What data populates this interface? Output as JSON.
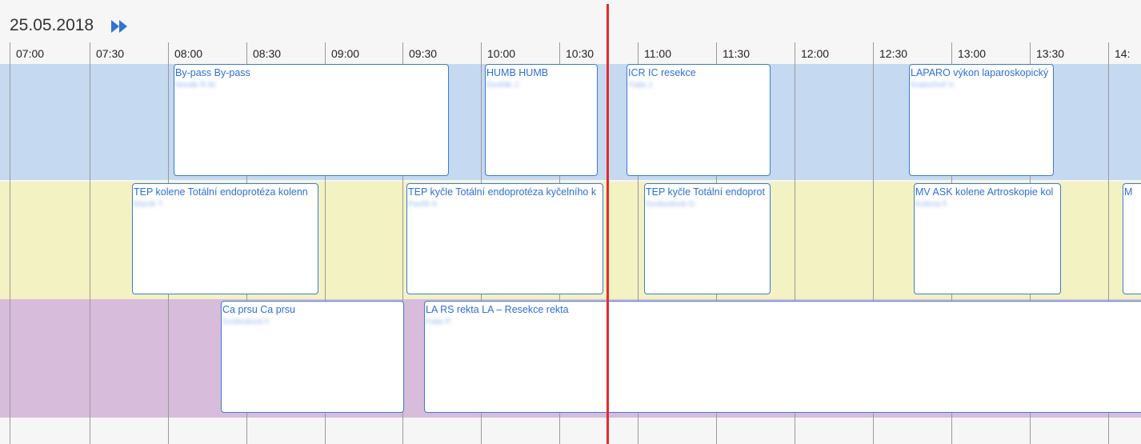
{
  "header": {
    "date": "25.05.2018",
    "next_icon": "double-chevron-right-icon"
  },
  "time_ticks": [
    "07:00",
    "07:30",
    "08:00",
    "08:30",
    "09:00",
    "09:30",
    "10:00",
    "10:30",
    "11:00",
    "11:30",
    "12:00",
    "12:30",
    "13:00",
    "13:30",
    "14:"
  ],
  "colors": {
    "lane_1": "#c5d9f0",
    "lane_2": "#f2f2c3",
    "lane_3": "#d7bcdb",
    "booking_border": "#3f7ad6",
    "booking_text": "#2e6fd6",
    "now_line": "#e32b2b"
  },
  "lanes": [
    {
      "bookings": [
        {
          "title": "By-pass By-pass",
          "person": "Novák R.M."
        },
        {
          "title": "HUMB HUMB",
          "person": "Dvořák J."
        },
        {
          "title": "ICR IC resekce",
          "person": "Fiala J."
        },
        {
          "title": "LAPARO výkon laparoskopický",
          "person": "Kratochvíl V."
        }
      ]
    },
    {
      "bookings": [
        {
          "title": "TEP kolene Totální endoprotéza kolenn",
          "person": "Marek T."
        },
        {
          "title": "TEP kyčle Totální endoprotéza kyčelního k",
          "person": "Pavlík K."
        },
        {
          "title": "TEP kyčle Totální endoprot",
          "person": "Svobodová O."
        },
        {
          "title": "MV ASK kolene Artroskopie kol",
          "person": "Kolena F."
        },
        {
          "title": "M",
          "person": ""
        }
      ]
    },
    {
      "bookings": [
        {
          "title": "Ca prsu Ca prsu",
          "person": "Svobodová F."
        },
        {
          "title": "LA RS rekta LA – Resekce rekta",
          "person": "Fiala P."
        }
      ]
    }
  ]
}
